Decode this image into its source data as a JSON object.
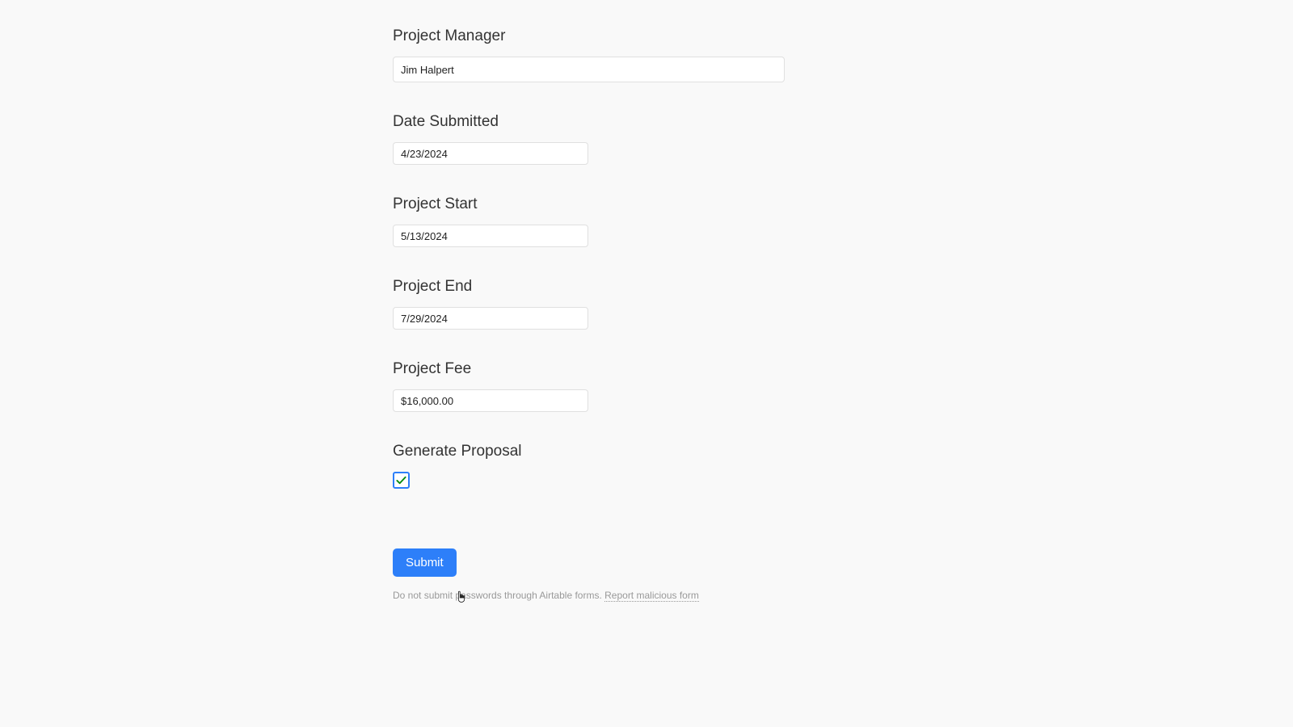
{
  "fields": {
    "project_manager": {
      "label": "Project Manager",
      "value": "Jim Halpert"
    },
    "date_submitted": {
      "label": "Date Submitted",
      "value": "4/23/2024"
    },
    "project_start": {
      "label": "Project Start",
      "value": "5/13/2024"
    },
    "project_end": {
      "label": "Project End",
      "value": "7/29/2024"
    },
    "project_fee": {
      "label": "Project Fee",
      "value": "$16,000.00"
    },
    "generate_proposal": {
      "label": "Generate Proposal",
      "checked": true
    }
  },
  "actions": {
    "submit_label": "Submit"
  },
  "footer": {
    "warning_text": "Do not submit passwords through Airtable forms. ",
    "report_link_text": "Report malicious form"
  }
}
